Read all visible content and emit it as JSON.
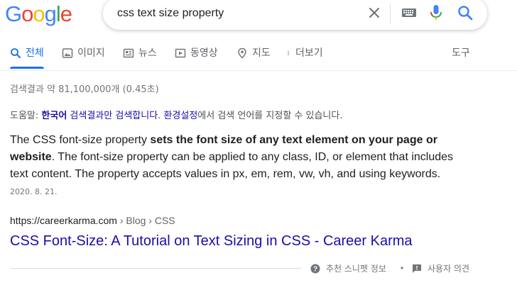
{
  "logo": {
    "letters": [
      "G",
      "o",
      "o",
      "g",
      "l",
      "e"
    ],
    "colors": [
      "#4285f4",
      "#ea4335",
      "#fbbc05",
      "#4285f4",
      "#34a853",
      "#ea4335"
    ]
  },
  "search": {
    "query": "css text size property"
  },
  "icons": {
    "clear": "close-icon",
    "keyboard": "keyboard-icon",
    "mic": "microphone-icon",
    "search": "search-icon"
  },
  "tabs": [
    {
      "label": "전체",
      "icon": "search-icon"
    },
    {
      "label": "이미지",
      "icon": "image-icon"
    },
    {
      "label": "뉴스",
      "icon": "news-icon"
    },
    {
      "label": "동영상",
      "icon": "video-icon"
    },
    {
      "label": "지도",
      "icon": "map-pin-icon"
    },
    {
      "label": "더보기",
      "icon": "more-vert-icon"
    }
  ],
  "tools_label": "도구",
  "stats": "검색결과 약 81,100,000개 (0.45초)",
  "helper": {
    "prefix": "도움말: ",
    "lang_link": "한국어",
    "link1": " 검색결과만 검색합니다",
    "middle": ". ",
    "settings_link": "환경설정",
    "suffix": "에서 검색 언어를 지정할 수 있습니다."
  },
  "snippet": {
    "part1": "The CSS font-size property ",
    "bold": "sets the font size of any text element on your page or website",
    "part2": ". The font-size property can be applied to any class, ID, or element that includes text content. The property accepts values in px, em, rem, vw, vh, and using keywords."
  },
  "date": "2020. 8. 21.",
  "result": {
    "domain": "https://careerkarma.com",
    "breadcrumb": " › Blog › CSS",
    "title": "CSS Font-Size: A Tutorial on Text Sizing in CSS - Career Karma"
  },
  "footer": {
    "snippet_label": "추천 스니펫 정보",
    "separator": "•",
    "feedback_label": "사용자 의견"
  },
  "colors": {
    "link": "#1a0dab",
    "accent": "#1a73e8"
  }
}
